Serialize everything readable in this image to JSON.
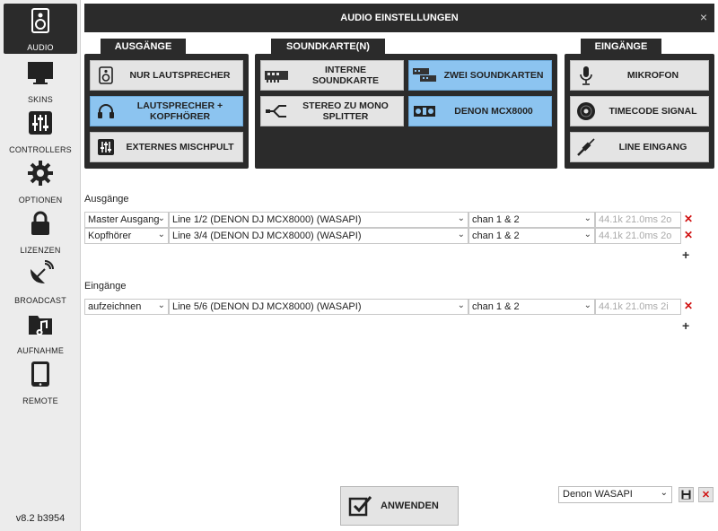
{
  "dialog": {
    "title": "AUDIO EINSTELLUNGEN",
    "close_glyph": "×"
  },
  "sidebar": {
    "items": [
      {
        "label": "AUDIO",
        "icon": "speaker-icon",
        "active": true
      },
      {
        "label": "SKINS",
        "icon": "monitor-icon"
      },
      {
        "label": "CONTROLLERS",
        "icon": "sliders-icon"
      },
      {
        "label": "OPTIONEN",
        "icon": "gear-icon"
      },
      {
        "label": "LIZENZEN",
        "icon": "lock-icon"
      },
      {
        "label": "BROADCAST",
        "icon": "satellite-dish-icon"
      },
      {
        "label": "AUFNAHME",
        "icon": "music-folder-icon"
      },
      {
        "label": "REMOTE",
        "icon": "tablet-icon"
      }
    ],
    "version": "v8.2 b3954"
  },
  "outputs_panel": {
    "tab": "AUSGÄNGE",
    "buttons": [
      {
        "label": "NUR LAUTSPRECHER",
        "icon": "speaker-icon",
        "selected": false
      },
      {
        "label": "LAUTSPRECHER + KOPFHÖRER",
        "icon": "headphones-icon",
        "selected": true
      },
      {
        "label": "EXTERNES MISCHPULT",
        "icon": "mixer-icon",
        "selected": false
      }
    ]
  },
  "soundcard_panel": {
    "tab": "SOUNDKARTE(N)",
    "buttons": [
      {
        "label": "INTERNE SOUNDKARTE",
        "icon": "sound-card-icon",
        "selected": false
      },
      {
        "label": "ZWEI SOUNDKARTEN",
        "icon": "two-sound-cards-icon",
        "selected": true
      },
      {
        "label": "STEREO ZU MONO SPLITTER",
        "icon": "splitter-cable-icon",
        "selected": false
      },
      {
        "label": "DENON MCX8000",
        "icon": "controller-icon",
        "selected": true
      }
    ]
  },
  "inputs_panel": {
    "tab": "EINGÄNGE",
    "buttons": [
      {
        "label": "MIKROFON",
        "icon": "microphone-icon",
        "selected": false
      },
      {
        "label": "TIMECODE SIGNAL",
        "icon": "vinyl-icon",
        "selected": false
      },
      {
        "label": "LINE EINGANG",
        "icon": "jack-cable-icon",
        "selected": false
      }
    ]
  },
  "outputs_section": {
    "label": "Ausgänge",
    "rows": [
      {
        "type": "Master Ausgang",
        "device": "Line 1/2 (DENON DJ MCX8000) (WASAPI)",
        "channels": "chan 1 & 2",
        "info": "44.1k 21.0ms 2o"
      },
      {
        "type": "Kopfhörer",
        "device": "Line 3/4 (DENON DJ MCX8000) (WASAPI)",
        "channels": "chan 1 & 2",
        "info": "44.1k 21.0ms 2o"
      }
    ],
    "add": "+"
  },
  "inputs_section": {
    "label": "Eingänge",
    "rows": [
      {
        "type": "aufzeichnen",
        "device": "Line 5/6 (DENON DJ MCX8000) (WASAPI)",
        "channels": "chan 1 & 2",
        "info": "44.1k 21.0ms 2i"
      }
    ],
    "add": "+"
  },
  "footer": {
    "apply_label": "ANWENDEN",
    "preset_value": "Denon WASAPI",
    "remove_glyph": "✕"
  },
  "colors": {
    "dark": "#2b2b2b",
    "selected": "#8cc4f0",
    "remove": "#d01010"
  }
}
